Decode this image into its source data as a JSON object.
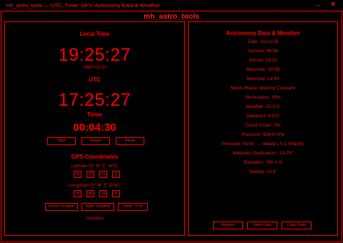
{
  "window": {
    "title": "mh_astro_tools — UTC, Timer, GPS, Astronomy Data & Weather",
    "minimize_glyph": "—",
    "close_glyph": "✕"
  },
  "app": {
    "title": "mh_astro_tools"
  },
  "local_time": {
    "heading": "Local Time",
    "time": "19:25:27",
    "tz": "GMT+02:00"
  },
  "utc": {
    "heading": "UTC",
    "time": "17:25:27"
  },
  "timer": {
    "heading": "Timer",
    "value": "00:04:30",
    "start_label": "Start",
    "pause_label": "Pause",
    "reset_label": "Reset"
  },
  "gps": {
    "heading": "GPS Coordinates",
    "lat_label": "Latitude (0° M' S\" N/S):",
    "lat": [
      "24",
      "29",
      "01",
      "S"
    ],
    "lon_label": "Longitude (0° M' S\" E/W):",
    "lon": [
      "15",
      "45",
      "29",
      "E"
    ],
    "fetch_label": "Fetch Location",
    "save_label": "Save Location",
    "units_label": "Units: °C/m",
    "status": "Updated"
  },
  "astro": {
    "heading": "Astronomy Data & Weather",
    "lines": [
      "Date: 01/12/26",
      "Sunrise: 06:06",
      "Sunset: 19:52",
      "Moonrise: 00:56",
      "Moonset: 14:43",
      "Moon Phase: Waning Crescent",
      "Illumination: 39%",
      "Weather: 25.3°C",
      "Dewpoint: 4.5°C",
      "Cloud Cover: 0%",
      "Pressure: 924.9 hPa",
      "Pressure Trend: → steady (-0.1 hPa/3h)",
      "Magnetic Declination: -13.76°",
      "Elevation: 785.0 m",
      "Seeing: <0.5\""
    ],
    "refresh_label": "Refresh",
    "save_data_label": "Save Data",
    "copy_data_label": "Copy Data"
  }
}
